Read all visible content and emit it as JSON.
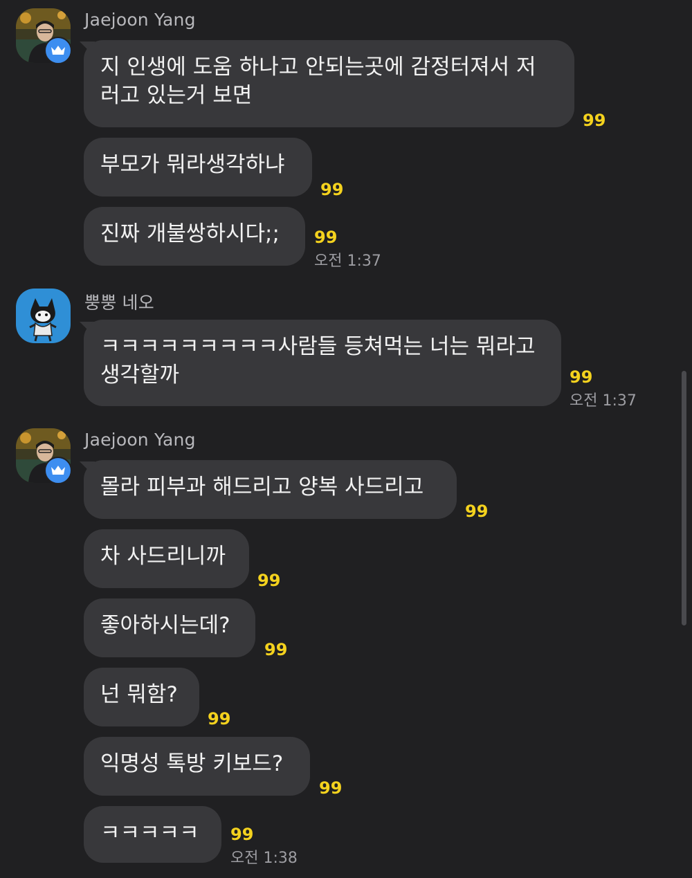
{
  "colors": {
    "background": "#202022",
    "bubble": "#38383b",
    "count": "#f4d21e",
    "time": "#9d9da2",
    "crown_badge": "#3d8ef0"
  },
  "groups": [
    {
      "sender": "Jaejoon Yang",
      "avatar": "profile-photo",
      "messages": [
        {
          "text": "지 인생에 도움 하나고 안되는곳에 감정터져서 저\n러고 있는거 보면",
          "count": "99",
          "time": ""
        },
        {
          "text": "부모가 뭐라생각하냐",
          "count": "99",
          "time": ""
        },
        {
          "text": "진짜 개불쌍하시다;;",
          "count": "99",
          "time": "오전 1:37"
        }
      ]
    },
    {
      "sender": "뿡뿡 네오",
      "avatar": "neo-character",
      "messages": [
        {
          "text": "ㅋㅋㅋㅋㅋㅋㅋㅋㅋ사람들 등쳐먹는 너는 뭐라고\n생각할까",
          "count": "99",
          "time": "오전 1:37"
        }
      ]
    },
    {
      "sender": "Jaejoon Yang",
      "avatar": "profile-photo",
      "messages": [
        {
          "text": "몰라 피부과 해드리고 양복 사드리고",
          "count": "99",
          "time": ""
        },
        {
          "text": "차 사드리니까",
          "count": "99",
          "time": ""
        },
        {
          "text": "좋아하시는데?",
          "count": "99",
          "time": ""
        },
        {
          "text": "넌 뭐함?",
          "count": "99",
          "time": ""
        },
        {
          "text": "익명성 톡방 키보드?",
          "count": "99",
          "time": ""
        },
        {
          "text": "ㅋㅋㅋㅋㅋ",
          "count": "99",
          "time": "오전 1:38"
        }
      ]
    }
  ]
}
